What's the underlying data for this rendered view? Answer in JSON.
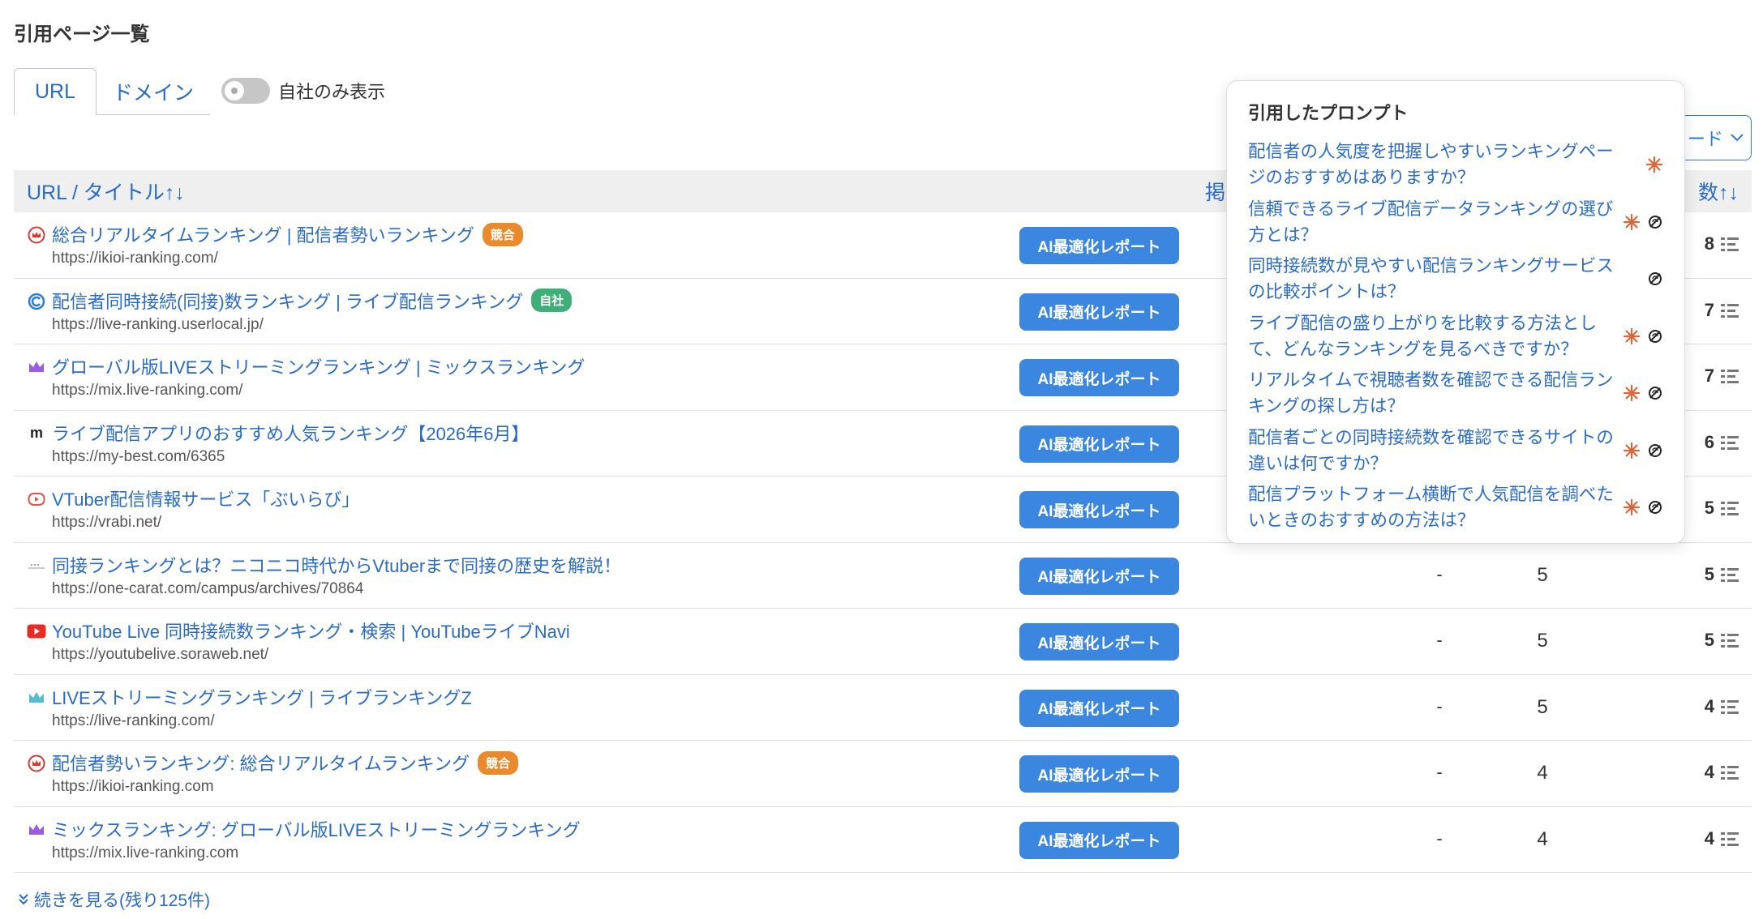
{
  "page_title": "引用ページ一覧",
  "tabs": [
    {
      "label": "URL"
    },
    {
      "label": "ドメイン"
    }
  ],
  "toggle": {
    "label": "自社のみ表示",
    "on": false
  },
  "download_button": {
    "label": "ード"
  },
  "table": {
    "header_title": "URL / タイトル↑↓",
    "header_mid": "掲",
    "header_count": "数↑↓",
    "ai_button_label": "AI最適化レポート",
    "rows": [
      {
        "favicon": "crown-red-icon",
        "title": "総合リアルタイムランキング | 配信者勢いランキング",
        "badge": "競合",
        "badge_type": "kyogo",
        "url": "https://ikioi-ranking.com/",
        "col_a": "",
        "col_b": "",
        "count": "8"
      },
      {
        "favicon": "swirl-blue-icon",
        "title": "配信者同時接続(同接)数ランキング | ライブ配信ランキング",
        "badge": "自社",
        "badge_type": "jisha",
        "url": "https://live-ranking.userlocal.jp/",
        "col_a": "",
        "col_b": "",
        "count": "7"
      },
      {
        "favicon": "crown-purple-icon",
        "title": "グローバル版LIVEストリーミングランキング | ミックスランキング",
        "badge": "",
        "badge_type": "",
        "url": "https://mix.live-ranking.com/",
        "col_a": "",
        "col_b": "",
        "count": "7"
      },
      {
        "favicon": "m-letter-icon",
        "title": "ライブ配信アプリのおすすめ人気ランキング【2026年6月】",
        "badge": "",
        "badge_type": "",
        "url": "https://my-best.com/6365",
        "col_a": "",
        "col_b": "",
        "count": "6"
      },
      {
        "favicon": "vrabi-icon",
        "title": "VTuber配信情報サービス「ぶいらび」",
        "badge": "",
        "badge_type": "",
        "url": "https://vrabi.net/",
        "col_a": "",
        "col_b": "",
        "count": "5"
      },
      {
        "favicon": "dots-line-icon",
        "title": "同接ランキングとは？ニコニコ時代からVtuberまで同接の歴史を解説！",
        "badge": "",
        "badge_type": "",
        "url": "https://one-carat.com/campus/archives/70864",
        "col_a": "-",
        "col_b": "5",
        "count": "5"
      },
      {
        "favicon": "youtube-icon",
        "title": "YouTube Live 同時接続数ランキング・検索 | YouTubeライブNavi",
        "badge": "",
        "badge_type": "",
        "url": "https://youtubelive.soraweb.net/",
        "col_a": "-",
        "col_b": "5",
        "count": "5"
      },
      {
        "favicon": "crown-teal-icon",
        "title": "LIVEストリーミングランキング | ライブランキングZ",
        "badge": "",
        "badge_type": "",
        "url": "https://live-ranking.com/",
        "col_a": "-",
        "col_b": "5",
        "count": "4"
      },
      {
        "favicon": "crown-red-icon",
        "title": "配信者勢いランキング: 総合リアルタイムランキング",
        "badge": "競合",
        "badge_type": "kyogo",
        "url": "https://ikioi-ranking.com",
        "col_a": "-",
        "col_b": "4",
        "count": "4"
      },
      {
        "favicon": "crown-purple-icon",
        "title": "ミックスランキング: グローバル版LIVEストリーミングランキング",
        "badge": "",
        "badge_type": "",
        "url": "https://mix.live-ranking.com",
        "col_a": "-",
        "col_b": "4",
        "count": "4"
      }
    ]
  },
  "more_link": "続きを見る(残り125件)",
  "popover": {
    "title": "引用したプロンプト",
    "prompts": [
      {
        "text": "配信者の人気度を把握しやすいランキングページのおすすめはありますか？",
        "icons": [
          "spark-icon"
        ]
      },
      {
        "text": "信頼できるライブ配信データランキングの選び方とは？",
        "icons": [
          "spark-icon",
          "openai-icon"
        ]
      },
      {
        "text": "同時接続数が見やすい配信ランキングサービスの比較ポイントは？",
        "icons": [
          "openai-icon"
        ]
      },
      {
        "text": "ライブ配信の盛り上がりを比較する方法として、どんなランキングを見るべきですか？",
        "icons": [
          "spark-icon",
          "openai-icon"
        ]
      },
      {
        "text": "リアルタイムで視聴者数を確認できる配信ランキングの探し方は？",
        "icons": [
          "spark-icon",
          "openai-icon"
        ]
      },
      {
        "text": "配信者ごとの同時接続数を確認できるサイトの違いは何ですか？",
        "icons": [
          "spark-icon",
          "openai-icon"
        ]
      },
      {
        "text": "配信プラットフォーム横断で人気配信を調べたいときのおすすめの方法は？",
        "icons": [
          "spark-icon",
          "openai-icon"
        ]
      }
    ]
  },
  "colors": {
    "link": "#2a6bc4",
    "button": "#3b87e0",
    "badge_kyogo": "#e98a2c",
    "badge_jisha": "#3fae78",
    "spark": "#d9673a"
  }
}
